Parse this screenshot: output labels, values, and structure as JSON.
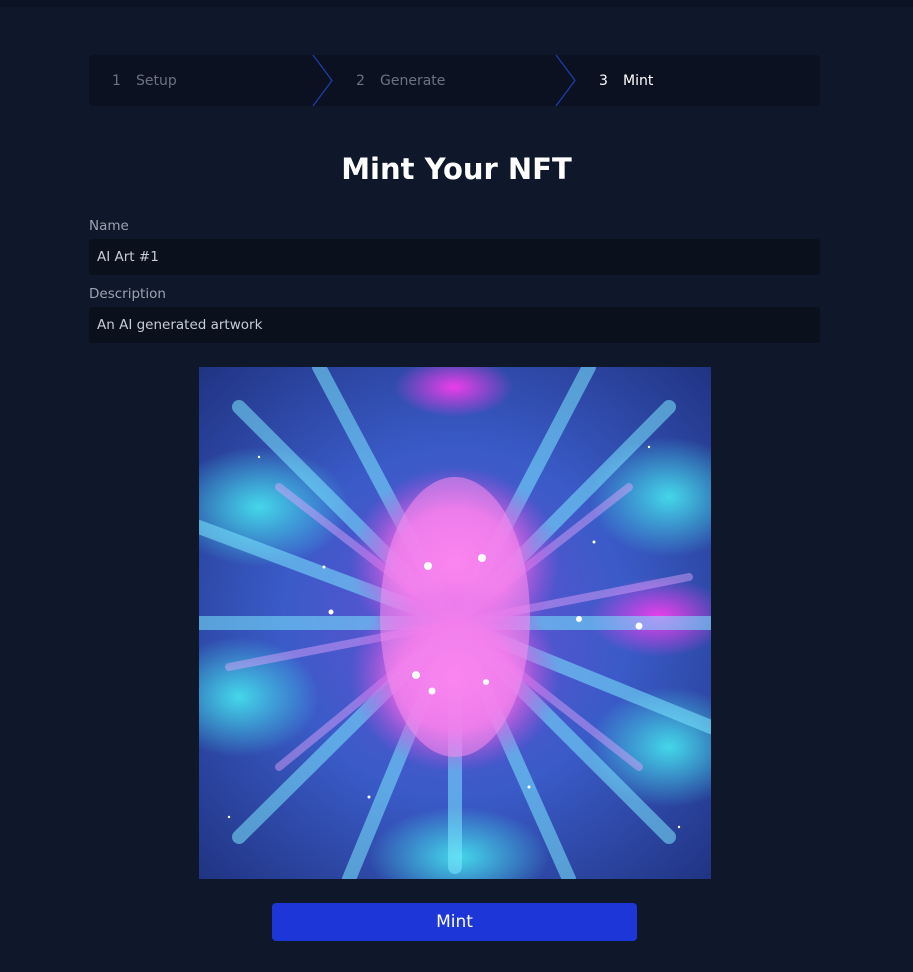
{
  "stepper": {
    "steps": [
      {
        "number": "1",
        "label": "Setup",
        "state": "inactive"
      },
      {
        "number": "2",
        "label": "Generate",
        "state": "inactive"
      },
      {
        "number": "3",
        "label": "Mint",
        "state": "active"
      }
    ]
  },
  "page": {
    "title": "Mint Your NFT"
  },
  "form": {
    "name_label": "Name",
    "name_value": "AI Art #1",
    "description_label": "Description",
    "description_value": "An AI generated artwork"
  },
  "artwork": {
    "icon": "generated-artwork-image"
  },
  "actions": {
    "mint_label": "Mint"
  },
  "colors": {
    "background": "#0f172a",
    "accent": "#1d36d8",
    "chevron": "#1e3fb0"
  }
}
